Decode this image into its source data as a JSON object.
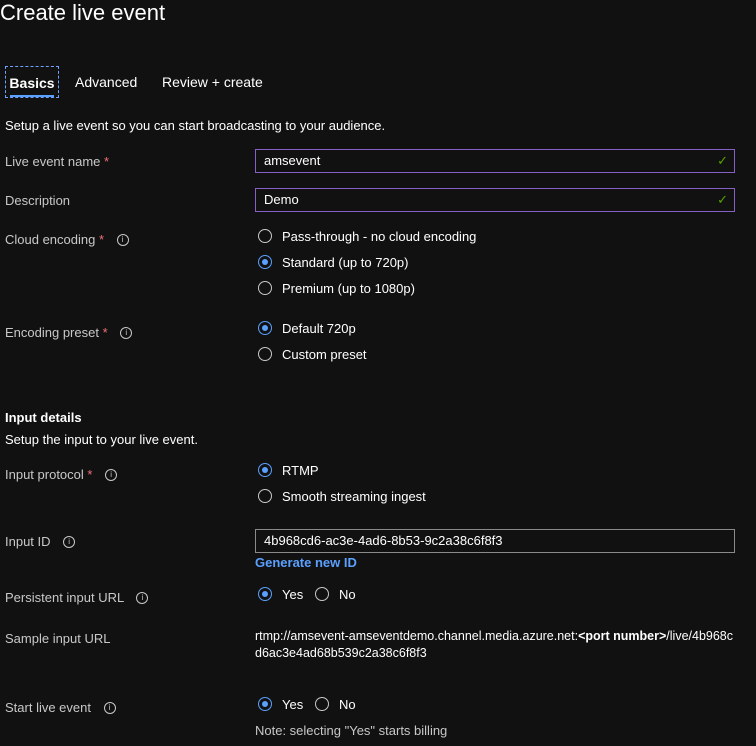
{
  "page": {
    "title": "Create live event"
  },
  "tabs": [
    {
      "label": "Basics"
    },
    {
      "label": "Advanced"
    },
    {
      "label": "Review + create"
    }
  ],
  "intro": "Setup a live event so you can start broadcasting to your audience.",
  "fields": {
    "live_event_name": {
      "label": "Live event name",
      "required": "*",
      "value": "amsevent"
    },
    "description": {
      "label": "Description",
      "value": "Demo"
    },
    "cloud_encoding": {
      "label": "Cloud encoding",
      "required": "*",
      "options": [
        "Pass-through - no cloud encoding",
        "Standard (up to 720p)",
        "Premium (up to 1080p)"
      ],
      "selected": "Standard (up to 720p)"
    },
    "encoding_preset": {
      "label": "Encoding preset",
      "required": "*",
      "options": [
        "Default 720p",
        "Custom preset"
      ],
      "selected": "Default 720p"
    }
  },
  "input_details": {
    "heading": "Input details",
    "subtext": "Setup the input to your live event.",
    "input_protocol": {
      "label": "Input protocol",
      "required": "*",
      "options": [
        "RTMP",
        "Smooth streaming ingest"
      ],
      "selected": "RTMP"
    },
    "input_id": {
      "label": "Input ID",
      "value": "4b968cd6-ac3e-4ad6-8b53-9c2a38c6f8f3",
      "generate_link": "Generate new ID"
    },
    "persistent_input_url": {
      "label": "Persistent input URL",
      "options": [
        "Yes",
        "No"
      ],
      "selected": "Yes"
    },
    "sample_input_url": {
      "label": "Sample input URL",
      "part1": "rtmp://amsevent-amseventdemo.channel.media.azure.net:",
      "port": "<port number>",
      "part2": "/live/4b968cd6ac3e4ad68b539c2a38c6f8f3"
    },
    "start_live_event": {
      "label": "Start live event",
      "options": [
        "Yes",
        "No"
      ],
      "selected": "Yes",
      "note": "Note: selecting \"Yes\" starts billing"
    }
  },
  "icons": {
    "info": "info-icon",
    "check": "checkmark-icon"
  },
  "colors": {
    "accent": "#5aa0ff",
    "required": "#f1707b",
    "valid_border": "#8661c5",
    "check": "#57a300"
  }
}
